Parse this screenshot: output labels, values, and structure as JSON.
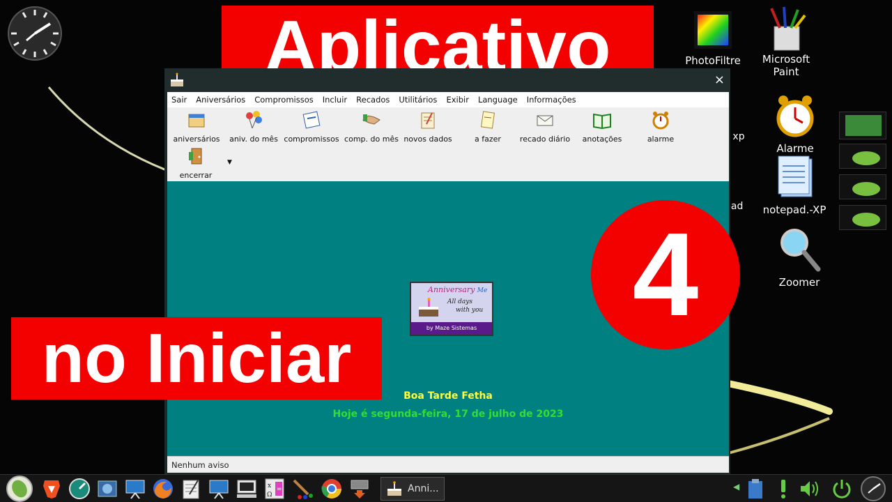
{
  "banners": {
    "top": "Aplicativo",
    "bottom": "no Iniciar",
    "number": "4"
  },
  "desktop_icons": [
    {
      "label": "PhotoFiltre",
      "icon": "photofiltre-icon"
    },
    {
      "label": "Microsoft\nPaint",
      "icon": "paint-icon"
    },
    {
      "label": "Alarme",
      "icon": "alarm-clock-icon"
    },
    {
      "label": "notepad.-XP",
      "icon": "notepad-icon"
    },
    {
      "label": "Zoomer",
      "icon": "magnifier-icon"
    },
    {
      "label": "xp",
      "icon": "partial-icon"
    },
    {
      "label": "pad",
      "icon": "partial-icon"
    }
  ],
  "window": {
    "close": "×",
    "menu": [
      "Sair",
      "Aniversários",
      "Compromissos",
      "Incluir",
      "Recados",
      "Utilitários",
      "Exibir",
      "Language",
      "Informações"
    ],
    "toolbar": [
      {
        "label": "aniversários",
        "icon": "calendar-icon"
      },
      {
        "label": "aniv. do mês",
        "icon": "balloons-icon"
      },
      {
        "label": "compromissos",
        "icon": "appointments-icon"
      },
      {
        "label": "comp. do mês",
        "icon": "handshake-icon"
      },
      {
        "label": "novos dados",
        "icon": "new-data-icon"
      },
      {
        "label": "a fazer",
        "icon": "todo-icon"
      },
      {
        "label": "recado diário",
        "icon": "message-icon"
      },
      {
        "label": "anotações",
        "icon": "book-icon"
      },
      {
        "label": "alarme",
        "icon": "alarm-icon"
      },
      {
        "label": "encerrar",
        "icon": "exit-door-icon"
      }
    ],
    "logo": {
      "title": "Anniversary",
      "title_suffix": "Me",
      "line1": "All days",
      "line2": "with you",
      "footer": "by Maze Sistemas"
    },
    "greeting": "Boa Tarde Fetha",
    "date_line": "Hoje é segunda-feira, 17 de julho de 2023",
    "status": "Nenhum aviso"
  },
  "taskbar": {
    "task_label": "Anni..."
  },
  "colors": {
    "banner_red": "#f30000",
    "content_teal": "#008080",
    "greeting_yellow": "#ffff40",
    "date_green": "#30e030"
  }
}
